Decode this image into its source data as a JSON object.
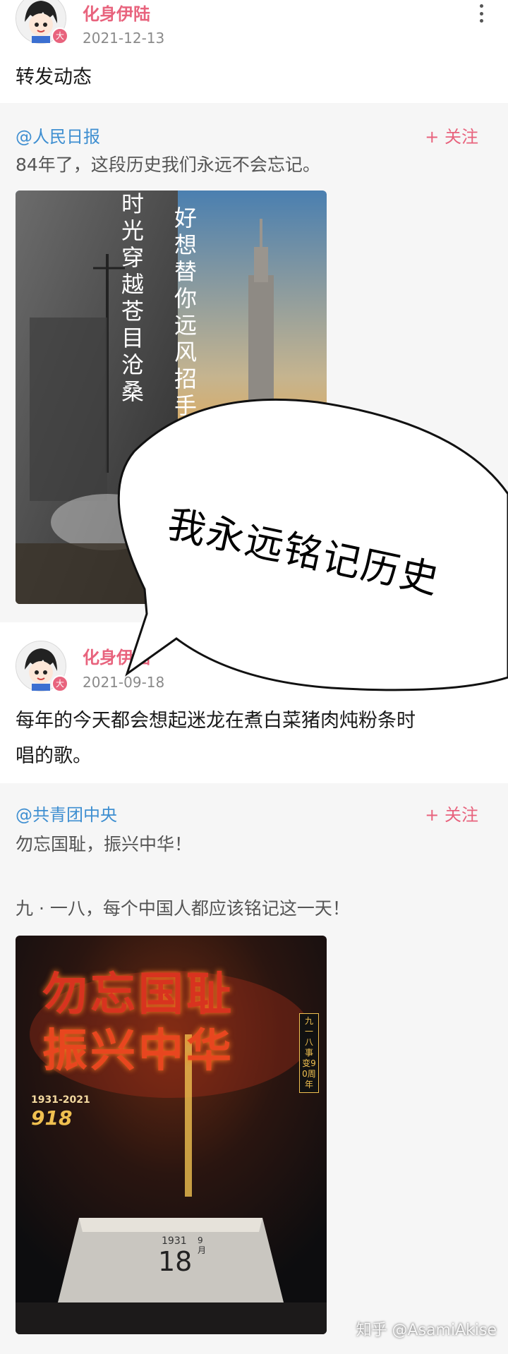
{
  "post1": {
    "author": "化身伊陆",
    "date": "2021-12-13",
    "text": "转发动态",
    "badge": "大",
    "more_icon": "more-vertical-icon"
  },
  "repost1": {
    "author": "@人民日报",
    "follow": "+ 关注",
    "text": "84年了，这段历史我们永远不会忘记。",
    "image_calligraphy_left": "时光穿越苍目沧桑",
    "image_calligraphy_right": "好想替你远风招手"
  },
  "bubble": {
    "text": "我永远铭记历史"
  },
  "post2": {
    "author": "化身伊陆",
    "date": "2021-09-18",
    "text_line1": "每年的今天都会想起迷龙在煮白菜猪肉炖粉条时",
    "text_line2": "唱的歌。",
    "badge": "大"
  },
  "repost2": {
    "author": "@共青团中央",
    "follow": "+ 关注",
    "text1": "勿忘国耻，振兴中华！",
    "text2": "九 · 一八，每个中国人都应该铭记这一天！",
    "poster": {
      "line1": "勿忘国耻",
      "line2": "振兴中华",
      "side": "九一八事变90周年",
      "years": "1931-2021",
      "number": "918",
      "calendar_year": "1931",
      "calendar_day": "18",
      "calendar_month": "9月"
    }
  },
  "watermark": "知乎 @AsamiAkise"
}
